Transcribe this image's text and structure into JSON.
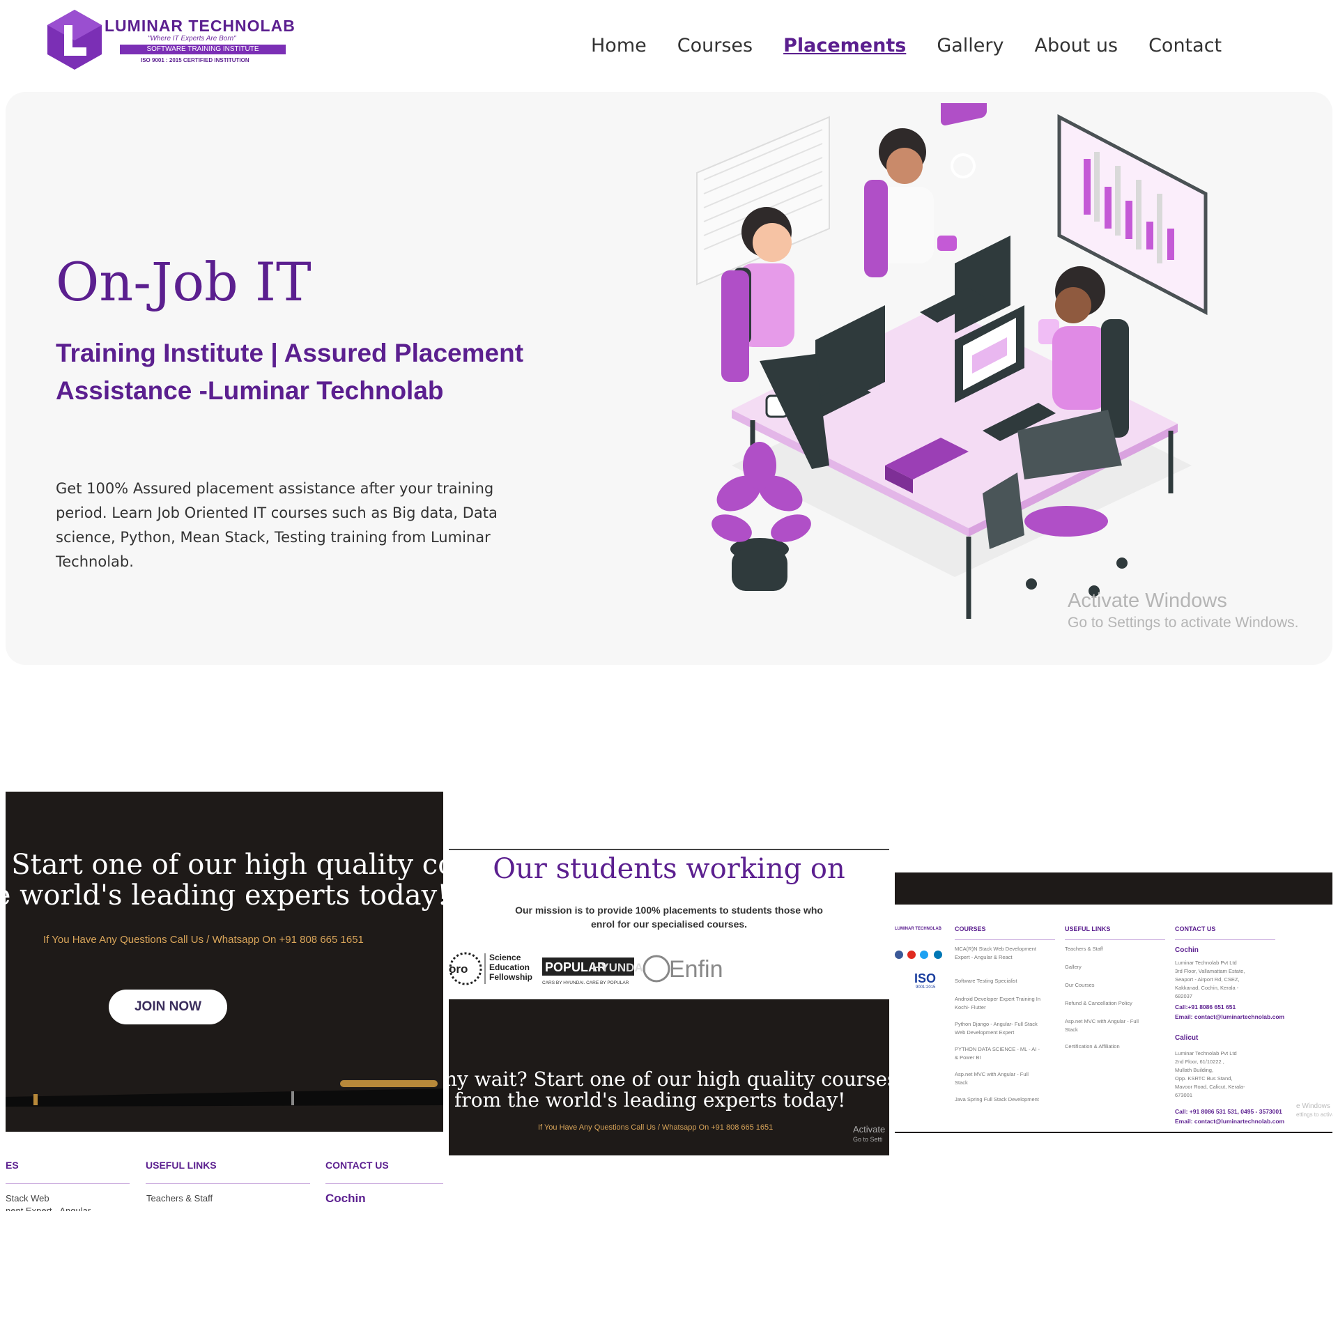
{
  "header": {
    "logo_name": "LUMINAR TECHNOLAB",
    "logo_tagline": "\"Where IT Experts Are Born\"",
    "logo_band": "SOFTWARE TRAINING INSTITUTE",
    "logo_iso": "ISO 9001 : 2015 CERTIFIED INSTITUTION",
    "nav": [
      "Home",
      "Courses",
      "Placements",
      "Gallery",
      "About us",
      "Contact"
    ],
    "active_nav": "Placements"
  },
  "hero": {
    "title": "On-Job IT",
    "subtitle_line1": "Training Institute | Assured Placement",
    "subtitle_line2": "Assistance -Luminar Technolab",
    "description": "Get 100% Assured placement assistance after your training period. Learn Job Oriented IT courses such as Big data, Data science, Python, Mean Stack, Testing training from Luminar Technolab.",
    "watermark_title": "Activate Windows",
    "watermark_sub": "Go to Settings to activate Windows."
  },
  "panel1": {
    "line1": "t? Start one of our high quality cou",
    "line2": "he world's leading experts today!",
    "call": "If You Have Any Questions Call Us / Whatsapp On +91 808 665 1651",
    "join_label": "JOIN NOW",
    "footer": {
      "col1_heading": "ES",
      "col2_heading": "USEFUL LINKS",
      "col3_heading": "CONTACT US",
      "col1_line1": "Stack Web",
      "col1_line2": "nent Expert - Angular",
      "col2_line1": "Teachers & Staff",
      "col3_city": "Cochin"
    }
  },
  "panel2": {
    "title": "Our students working on",
    "mission": "Our mission is to provide 100% placements to students those who enrol for our specialised courses.",
    "logos": {
      "logo1_prefix": "oro",
      "logo1_text": [
        "Science",
        "Education",
        "Fellowship"
      ],
      "logo2_main": "POPULAR",
      "logo2_brand": "HYUNDAI",
      "logo2_sub": "CARS BY HYUNDAI. CARE BY POPULAR",
      "logo3": "Enfin"
    },
    "line1": "hy wait? Start one of our high quality courses",
    "line2": "from the world's leading experts today!",
    "call": "If You Have Any Questions Call Us / Whatsapp On +91 808 665 1651",
    "watermark1": "Activate",
    "watermark2": "Go to Setti"
  },
  "panel3": {
    "logo_text": "LUMINAR TECHNOLAB",
    "iso_label": "ISO",
    "iso_sub": "9001:2015",
    "headings": [
      "COURSES",
      "USEFUL LINKS",
      "CONTACT US"
    ],
    "courses": [
      "MCA(R)N Stack Web Development Expert - Angular & React",
      "Software Testing Specialist",
      "Android Developer Expert Training In Kochi- Flutter",
      "Python Django - Angular- Full Stack Web Development Expert",
      "PYTHON DATA SCIENCE - ML - AI - & Power BI",
      "Asp.net MVC with Angular - Full Stack",
      "Java Spring Full Stack Development"
    ],
    "links": [
      "Teachers & Staff",
      "Gallery",
      "Our Courses",
      "Refund & Cancellation Policy",
      "Asp.net MVC with Angular - Full Stack",
      "Certification & Affiliation"
    ],
    "cochin": {
      "city": "Cochin",
      "address": [
        "Luminar Technolab Pvt Ltd",
        "3rd Floor, Vallamattam Estate,",
        "Seaport - Airport Rd, CSEZ,",
        "Kakkanad, Cochin, Kerala -",
        "682037"
      ],
      "call": "Call:+91 8086 651 651",
      "email": "Email: contact@luminartechnolab.com"
    },
    "calicut": {
      "city": "Calicut",
      "address": [
        "Luminar Technolab Pvt Ltd",
        "2nd Floor, 61/10222 ,",
        "Mullath Building,",
        "Opp. KSRTC Bus Stand,",
        "Mavoor Road, Calicut, Kerala-",
        "673001"
      ],
      "call": "Call: +91 8086 531 531, 0495 - 3573001",
      "email": "Email: contact@luminartechnolab.com"
    },
    "watermark1": "e Windows",
    "watermark2": "ettings to activat"
  },
  "colors": {
    "brand_purple": "#5b1f8f",
    "accent_pink": "#c45ad6",
    "dark_panel": "#1e1a18",
    "gold_text": "#d9a55a"
  }
}
